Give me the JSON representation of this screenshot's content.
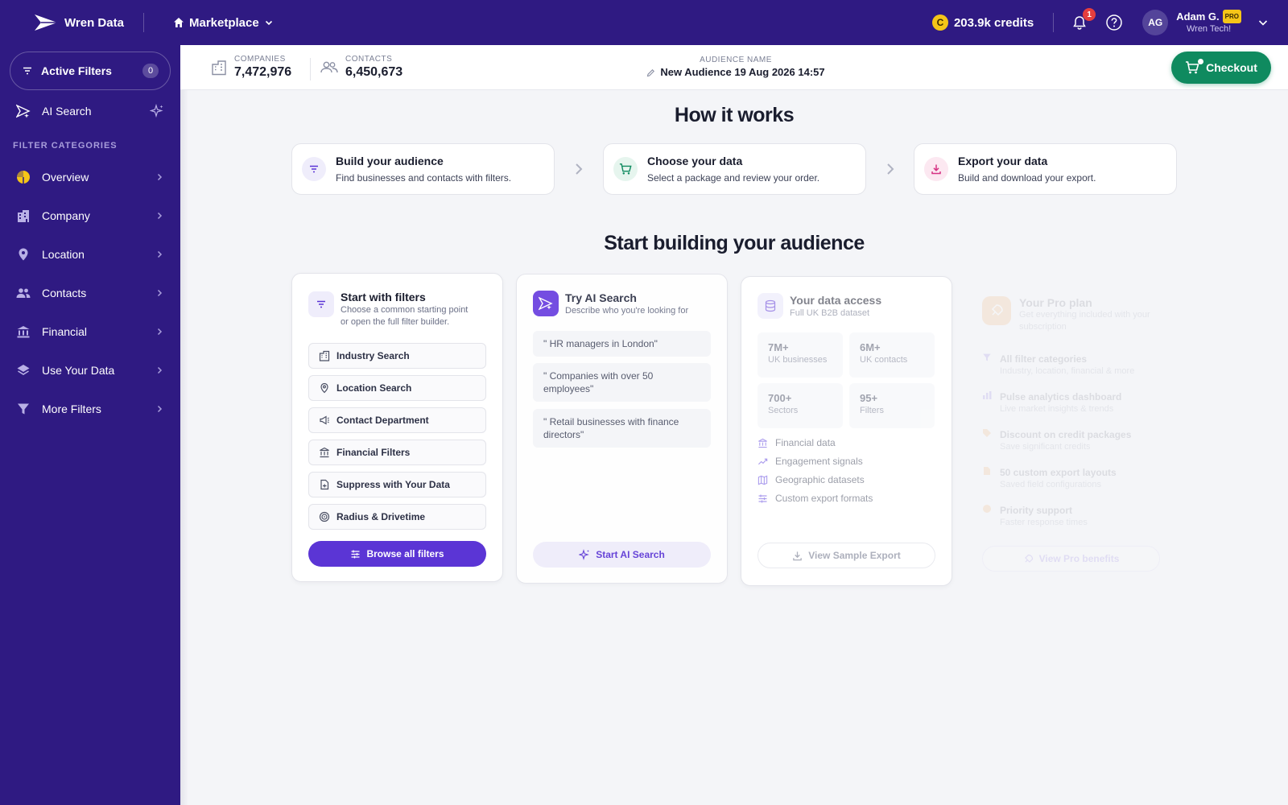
{
  "topbar": {
    "brand": "Wren Data",
    "marketplace_label": "Marketplace",
    "credits": "203.9k credits",
    "coin_symbol": "C",
    "notifications_count": "1",
    "user": {
      "initials": "AG",
      "name": "Adam G.",
      "badge": "PRO",
      "org": "Wren Tech!"
    }
  },
  "sidebar": {
    "active_filters_label": "Active Filters",
    "active_filters_count": "0",
    "ai_search_label": "AI Search",
    "categories_heading": "FILTER CATEGORIES",
    "items": [
      {
        "label": "Overview",
        "icon": "pie-chart-icon"
      },
      {
        "label": "Company",
        "icon": "building-icon"
      },
      {
        "label": "Location",
        "icon": "map-pin-icon"
      },
      {
        "label": "Contacts",
        "icon": "people-icon"
      },
      {
        "label": "Financial",
        "icon": "bank-icon"
      },
      {
        "label": "Use Your Data",
        "icon": "layers-icon"
      },
      {
        "label": "More Filters",
        "icon": "funnel-icon"
      }
    ]
  },
  "header": {
    "companies_label": "COMPANIES",
    "companies_value": "7,472,976",
    "contacts_label": "CONTACTS",
    "contacts_value": "6,450,673",
    "audience_label": "AUDIENCE NAME",
    "audience_value": "New Audience 19 Aug 2026 14:57",
    "checkout_label": "Checkout"
  },
  "how": {
    "title": "How it works",
    "steps": [
      {
        "title": "Build your audience",
        "desc": "Find businesses and contacts with filters.",
        "color": "#5b35d5"
      },
      {
        "title": "Choose your data",
        "desc": "Select a package and review your order.",
        "color": "#0f8a5f"
      },
      {
        "title": "Export your data",
        "desc": "Build and download your export.",
        "color": "#d63384"
      }
    ]
  },
  "start": {
    "title": "Start building your audience",
    "filters_card": {
      "title": "Start with filters",
      "subtitle_line1": "Choose a common starting point",
      "subtitle_line2": "or open the full filter builder.",
      "options": [
        "Industry Search",
        "Location Search",
        "Contact Department",
        "Financial Filters",
        "Suppress with Your Data",
        "Radius & Drivetime"
      ],
      "button": "Browse all filters"
    },
    "ai_card": {
      "title": "Try AI Search",
      "subtitle": "Describe who you're looking for",
      "prompts": [
        "\" HR managers in London\"",
        "\" Companies with over 50 employees\"",
        "\" Retail businesses with finance directors\""
      ],
      "button": "Start AI Search"
    },
    "data_card": {
      "title": "Your data access",
      "subtitle": "Full UK B2B dataset",
      "tiles": [
        {
          "value": "7M+",
          "label": "UK businesses"
        },
        {
          "value": "6M+",
          "label": "UK contacts"
        },
        {
          "value": "700+",
          "label": "Sectors"
        },
        {
          "value": "95+",
          "label": "Filters"
        }
      ],
      "features": [
        "Financial data",
        "Engagement signals",
        "Geographic datasets",
        "Custom export formats"
      ],
      "button": "View Sample Export"
    },
    "pro_card": {
      "title": "Your Pro plan",
      "subtitle_line1": "Get everything included with your",
      "subtitle_line2": "subscription",
      "benefits": [
        {
          "title": "All filter categories",
          "desc": "Industry, location, financial & more"
        },
        {
          "title": "Pulse analytics dashboard",
          "desc": "Live market insights & trends"
        },
        {
          "title": "Discount on credit packages",
          "desc": "Save significant credits"
        },
        {
          "title": "50 custom export layouts",
          "desc": "Saved field configurations"
        },
        {
          "title": "Priority support",
          "desc": "Faster response times"
        }
      ],
      "button": "View Pro benefits"
    }
  },
  "colors": {
    "nav_bg": "#2f1a82",
    "accent": "#5b35d5",
    "checkout": "#0f8a5f",
    "coin": "#f5c518"
  }
}
